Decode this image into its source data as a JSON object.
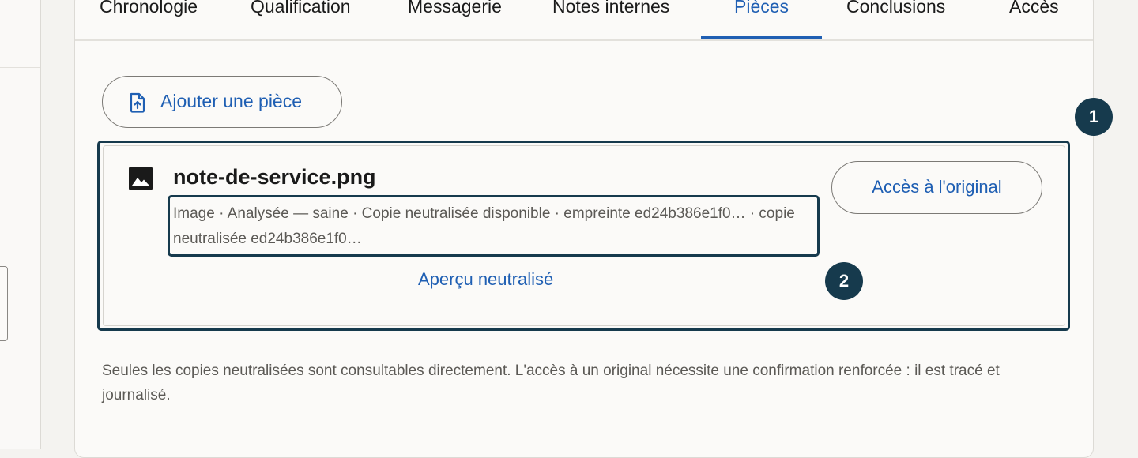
{
  "tabs": [
    {
      "label": "Chronologie",
      "active": false
    },
    {
      "label": "Qualification",
      "active": false
    },
    {
      "label": "Messagerie",
      "active": false
    },
    {
      "label": "Notes internes",
      "active": false
    },
    {
      "label": "Pièces",
      "active": true
    },
    {
      "label": "Conclusions",
      "active": false
    },
    {
      "label": "Accès",
      "active": false
    }
  ],
  "toolbar": {
    "add_label": "Ajouter une pièce",
    "add_icon": "file-upload-icon"
  },
  "callouts": {
    "first": "1",
    "second": "2"
  },
  "attachment": {
    "icon": "image-icon",
    "file_name": "note-de-service.png",
    "meta": "Image · Analysée — saine · Copie neutralisée disponible · empreinte ed24b386e1f0… · copie neutralisée ed24b386e1f0…",
    "preview_label": "Aperçu neutralisé",
    "original_label": "Accès à l'original"
  },
  "notice": "Seules les copies neutralisées sont consultables directement. L'accès à un original nécessite une confirmation renforcée : il est tracé et journalisé.",
  "colors": {
    "accent": "#1f5fb3",
    "callout": "#163a4d",
    "text": "#1a1a1a",
    "muted": "#5b5955"
  }
}
